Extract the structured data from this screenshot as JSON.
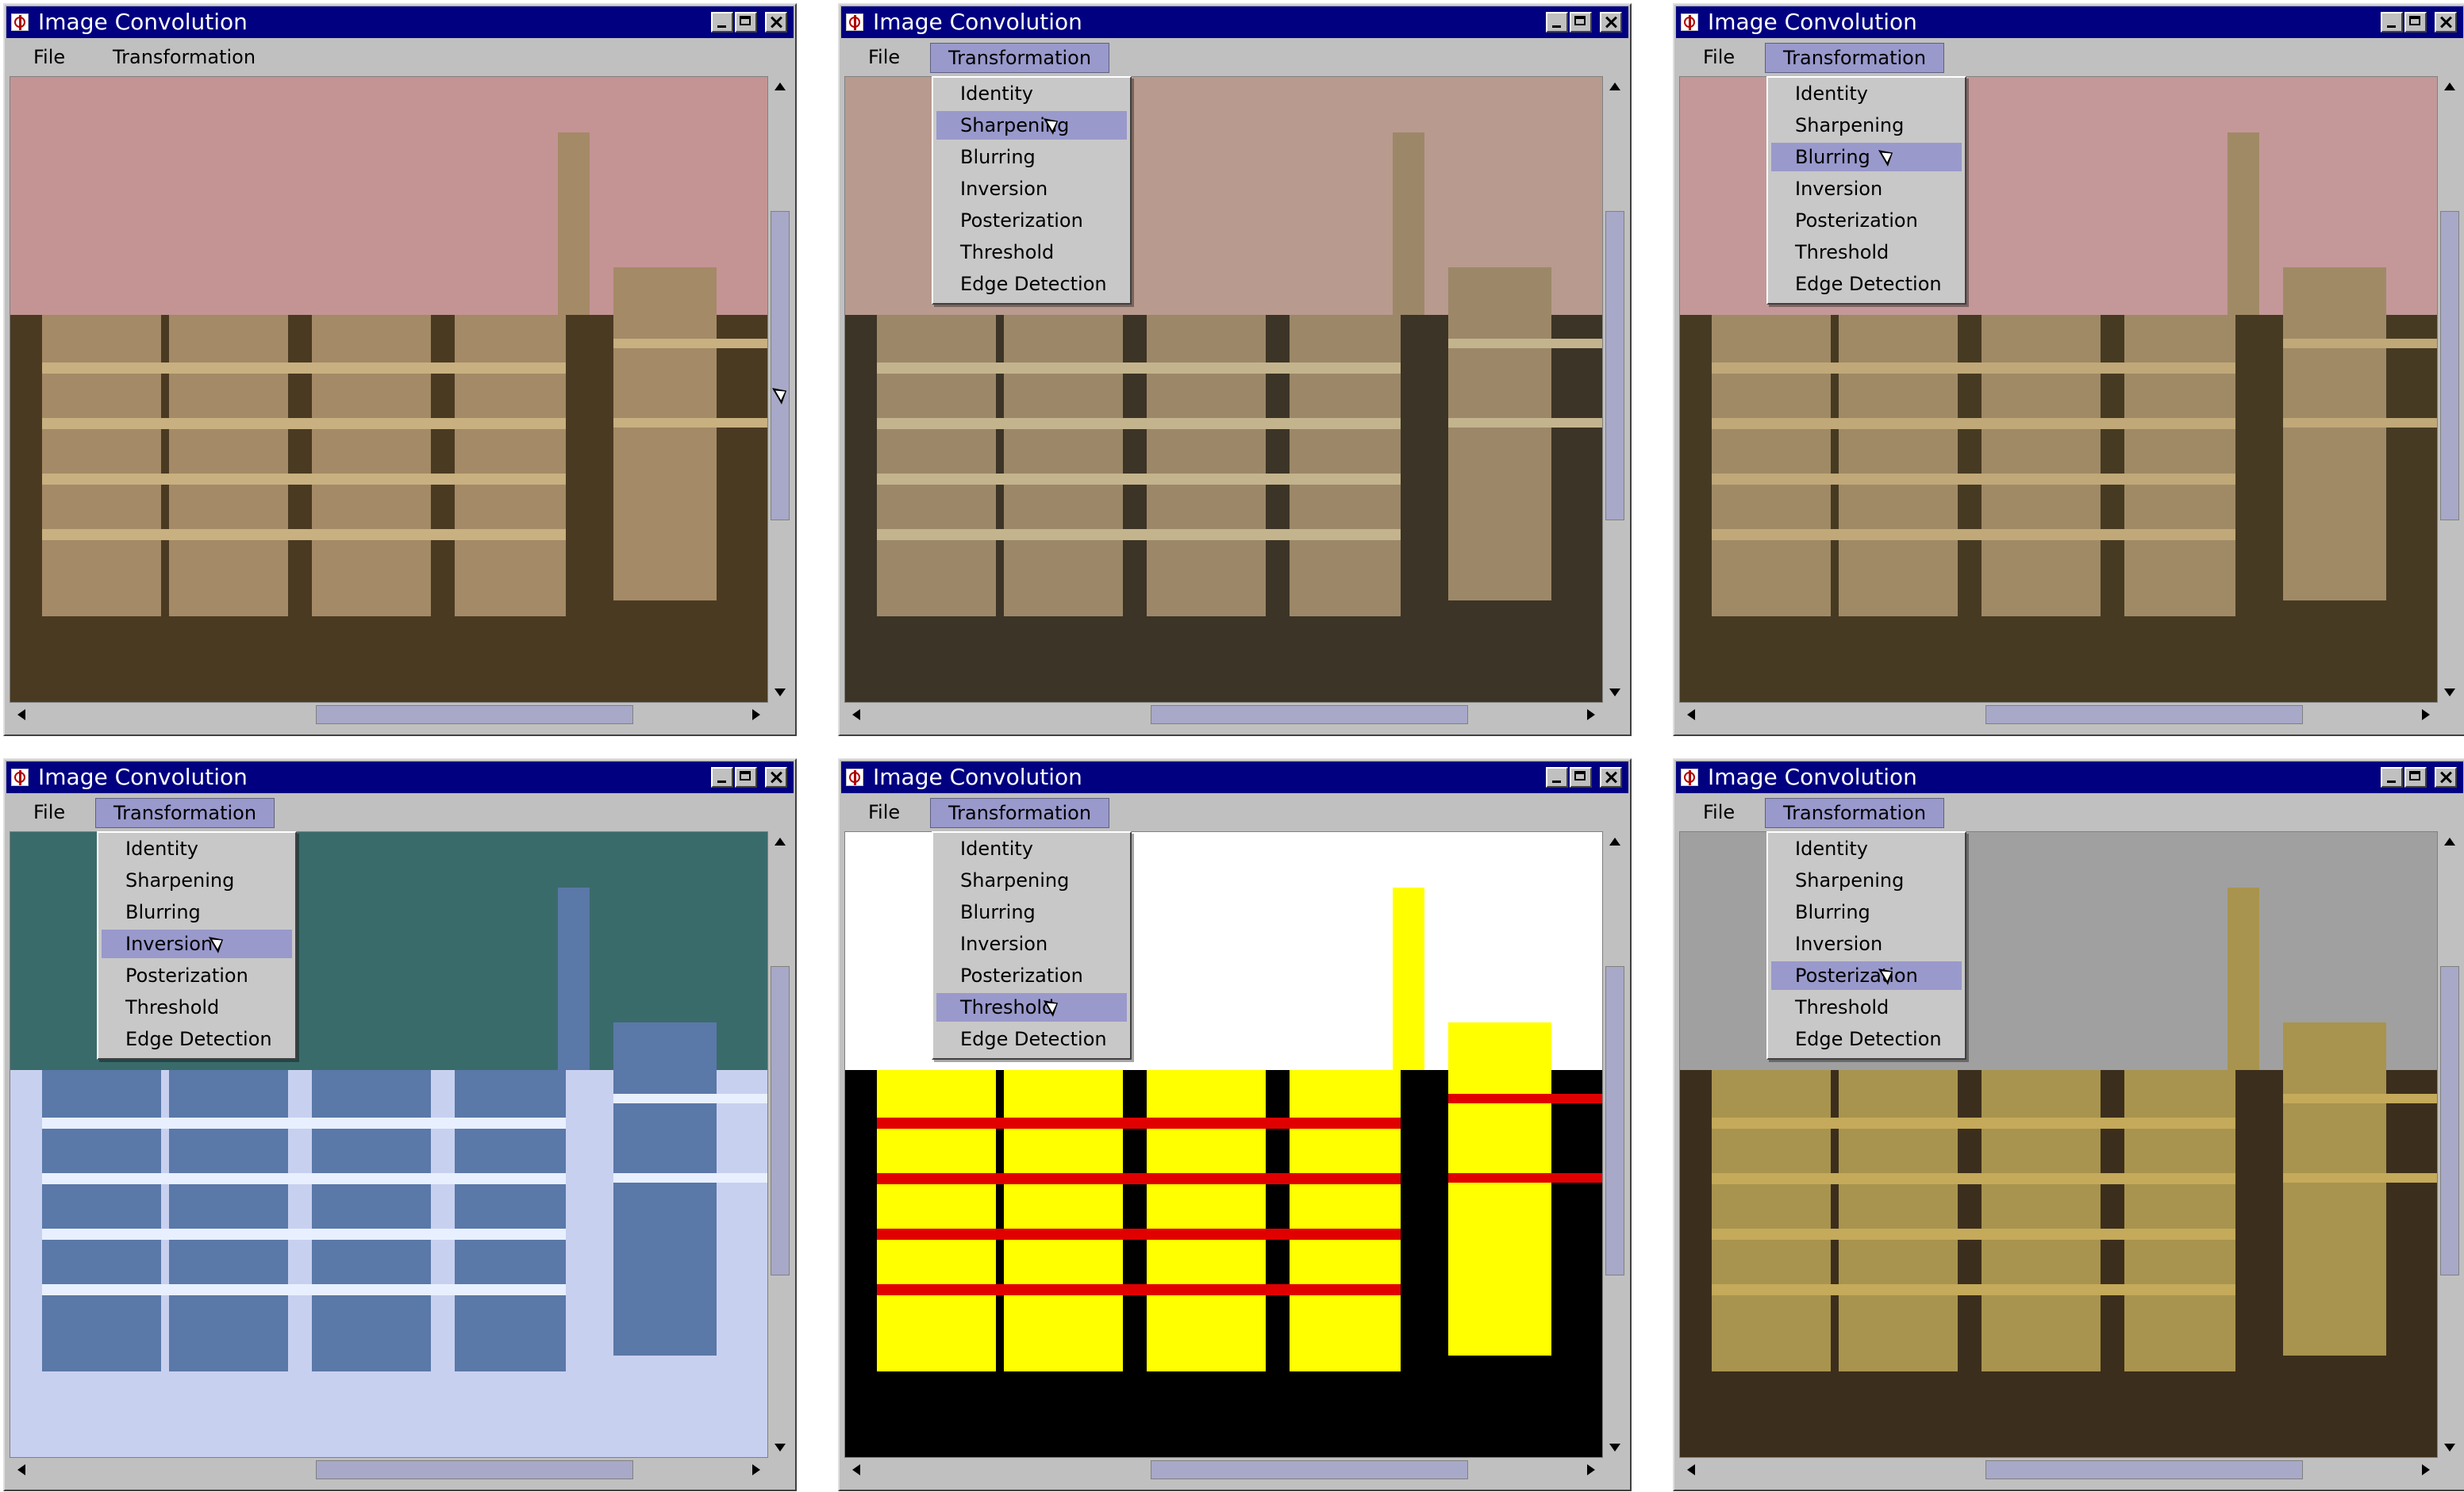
{
  "windows": [
    {
      "title": "Image Convolution",
      "menus": {
        "file": "File",
        "transformation": "Transformation"
      },
      "menu_open": false,
      "selected_index": -1,
      "image_colors": {
        "sky": "#c49494",
        "mid": "#a48a66",
        "dark": "#4a3a22",
        "accent": "#c8b080"
      }
    },
    {
      "title": "Image Convolution",
      "menus": {
        "file": "File",
        "transformation": "Transformation"
      },
      "menu_open": true,
      "selected_index": 1,
      "image_colors": {
        "sky": "#b89a8e",
        "mid": "#9c8868",
        "dark": "#3c3426",
        "accent": "#c4b48e"
      }
    },
    {
      "title": "Image Convolution",
      "menus": {
        "file": "File",
        "transformation": "Transformation"
      },
      "menu_open": true,
      "selected_index": 2,
      "image_colors": {
        "sky": "#c49898",
        "mid": "#a08a66",
        "dark": "#463a22",
        "accent": "#c0a878"
      }
    },
    {
      "title": "Image Convolution",
      "menus": {
        "file": "File",
        "transformation": "Transformation"
      },
      "menu_open": true,
      "selected_index": 3,
      "image_colors": {
        "sky": "#3a6b6b",
        "mid": "#5a78a8",
        "dark": "#c8d0f0",
        "accent": "#e8f0ff"
      }
    },
    {
      "title": "Image Convolution",
      "menus": {
        "file": "File",
        "transformation": "Transformation"
      },
      "menu_open": true,
      "selected_index": 5,
      "image_colors": {
        "sky": "#ffffff",
        "mid": "#ffff00",
        "dark": "#000000",
        "accent": "#e00000"
      }
    },
    {
      "title": "Image Convolution",
      "menus": {
        "file": "File",
        "transformation": "Transformation"
      },
      "menu_open": true,
      "selected_index": 4,
      "image_colors": {
        "sky": "#a0a0a0",
        "mid": "#a8944e",
        "dark": "#3c2e1c",
        "accent": "#c4aa5a"
      }
    }
  ],
  "transformation_items": [
    "Identity",
    "Sharpening",
    "Blurring",
    "Inversion",
    "Posterization",
    "Threshold",
    "Edge Detection"
  ],
  "colors": {
    "titlebar": "#000080",
    "window_face": "#c0c0c0",
    "menu_highlight": "#9999cc",
    "scroll_thumb": "#a8a8c8"
  }
}
